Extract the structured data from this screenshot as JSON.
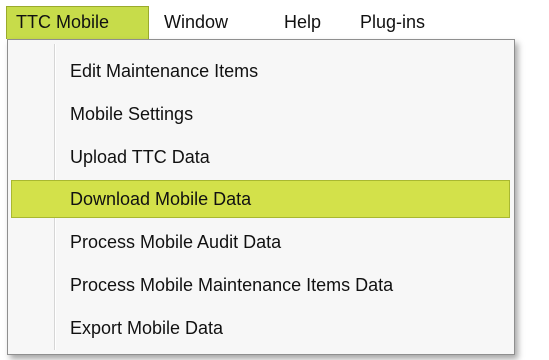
{
  "menubar": {
    "items": [
      {
        "label": "TTC Mobile"
      },
      {
        "label": "Window"
      },
      {
        "label": "Help"
      },
      {
        "label": "Plug-ins"
      }
    ]
  },
  "dropdown": {
    "items": [
      {
        "label": "Edit Maintenance Items"
      },
      {
        "label": "Mobile Settings"
      },
      {
        "label": "Upload TTC Data"
      },
      {
        "label": "Download Mobile Data"
      },
      {
        "label": "Process Mobile Audit Data"
      },
      {
        "label": "Process Mobile Maintenance Items Data"
      },
      {
        "label": "Export Mobile Data"
      }
    ],
    "highlighted_index": 3
  },
  "colors": {
    "highlight": "#d3e14a",
    "highlight_border": "#a9b830",
    "menu_background": "#f7f7f7"
  }
}
